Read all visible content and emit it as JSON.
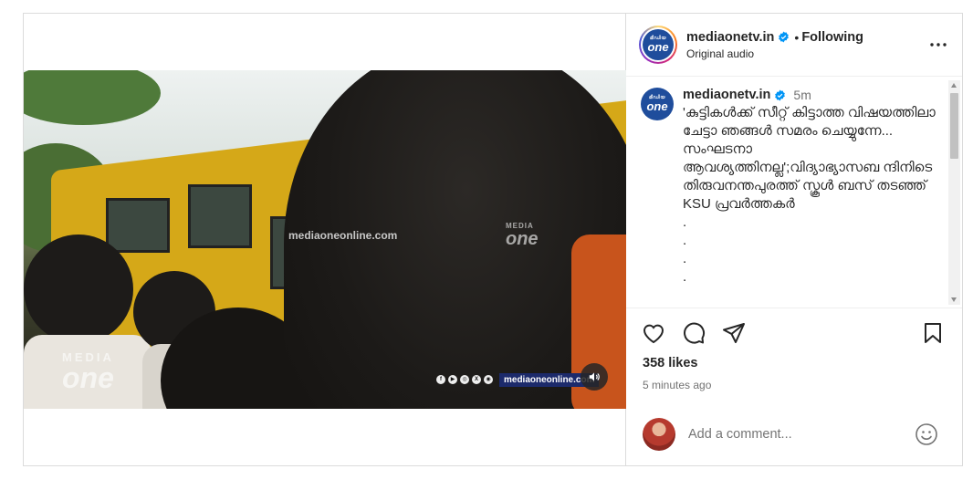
{
  "post": {
    "author": {
      "username": "mediaonetv.in",
      "verified_icon": "verified-badge-icon",
      "follow_separator": "•",
      "follow_status": "Following",
      "subtitle": "Original audio",
      "logo_top_text": "മീഡിയ",
      "logo_main_text": "one"
    },
    "caption": {
      "username": "mediaonetv.in",
      "time": "5m",
      "text": "'കുട്ടികൾക്ക് സീറ്റ് കിട്ടാത്ത വിഷയത്തിലാ ചേട്ടാ ഞങ്ങൾ സമരം ചെയ്യുന്നേ... സംഘടനാ ആവശ്യത്തിനല്ല';വിദ്യാഭ്യാസബ ന്ദിനിടെ തിരുവനന്തപുരത്ത് സ്കൂൾ ബസ് തടഞ്ഞ് KSU പ്രവർത്തകർ\n.\n.\n.\n."
    },
    "video": {
      "watermark_site": "mediaoneonline.com",
      "overlay_logo_top": "MEDIA",
      "overlay_logo_main": "one",
      "corner_logo_top": "MEDIA",
      "corner_logo_main": "one",
      "lower_third_site": "mediaoneonline.com",
      "social_icons": [
        "f",
        "▶",
        "◎",
        "X",
        "◉"
      ],
      "mute_icon": "speaker-icon"
    },
    "actions": {
      "like_icon": "heart-icon",
      "comment_icon": "comment-bubble-icon",
      "share_icon": "paper-plane-icon",
      "save_icon": "bookmark-icon"
    },
    "likes_text": "358 likes",
    "time_ago": "5 minutes ago",
    "comment": {
      "placeholder": "Add a comment...",
      "emoji_icon": "smiley-icon"
    }
  },
  "colors": {
    "border": "#dbdbdb",
    "text": "#262626",
    "muted": "#737373",
    "verified": "#0095f6",
    "brand": "#1f4d9c"
  }
}
